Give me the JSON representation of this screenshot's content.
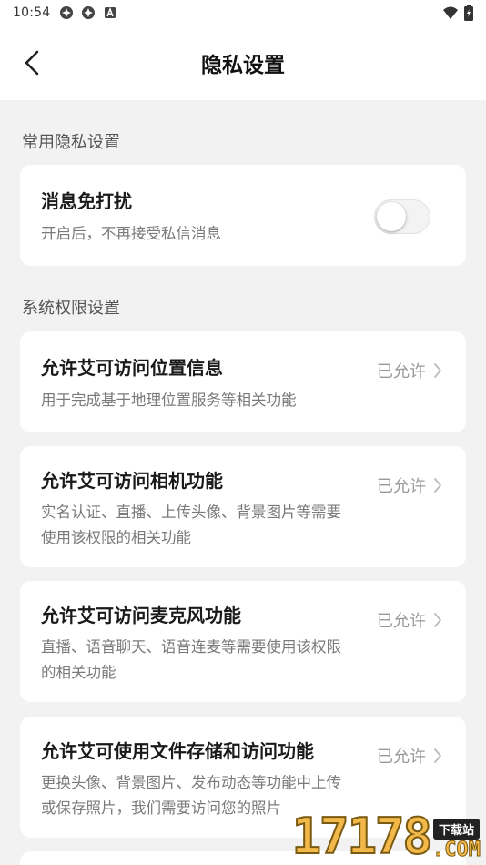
{
  "statusbar": {
    "time": "10:54",
    "icons": [
      "app-icon",
      "app-icon",
      "a-icon"
    ],
    "right_icons": [
      "wifi-icon",
      "battery-icon"
    ]
  },
  "appbar": {
    "title": "隐私设置",
    "back_icon": "chevron-left-icon"
  },
  "sections": {
    "common": {
      "label": "常用隐私设置",
      "dnd": {
        "title": "消息免打扰",
        "desc": "开启后，不再接受私信消息",
        "enabled": false
      }
    },
    "system": {
      "label": "系统权限设置",
      "items": [
        {
          "title": "允许艾可访问位置信息",
          "desc": "用于完成基于地理位置服务等相关功能",
          "status": "已允许"
        },
        {
          "title": "允许艾可访问相机功能",
          "desc": "实名认证、直播、上传头像、背景图片等需要使用该权限的相关功能",
          "status": "已允许"
        },
        {
          "title": "允许艾可访问麦克风功能",
          "desc": "直播、语音聊天、语音连麦等需要使用该权限的相关功能",
          "status": "已允许"
        },
        {
          "title": "允许艾可使用文件存储和访问功能",
          "desc": "更换头像、背景图片、发布动态等功能中上传或保存照片，我们需要访问您的照片",
          "status": "已允许"
        }
      ]
    }
  },
  "watermark": {
    "number": "17178",
    "tag": "下载站",
    "suffix": ".COM"
  },
  "colors": {
    "background": "#f2f2f2",
    "card": "#ffffff",
    "title_text": "#1a1a1a",
    "desc_text": "#7a7a7a",
    "status_text": "#999999"
  }
}
